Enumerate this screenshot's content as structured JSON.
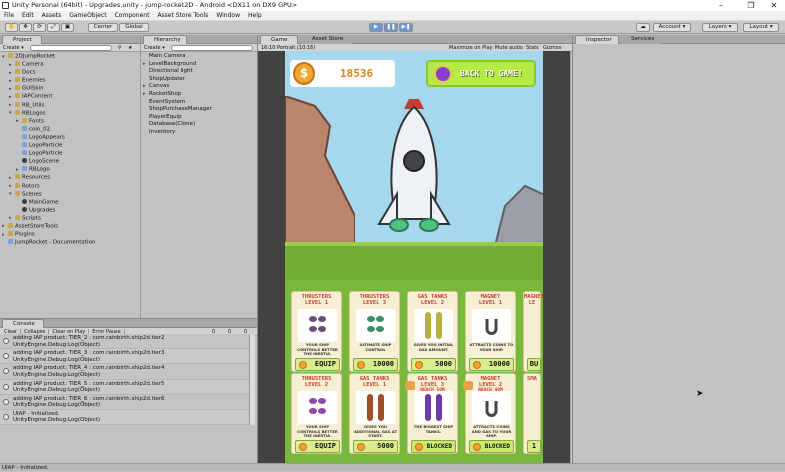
{
  "window": {
    "title": "Unity Personal (64bit) - Upgrades.unity - jump-rocket2D - Android <DX11 on DX9 GPU>",
    "minimize": "–",
    "maximize": "❐",
    "close": "✕"
  },
  "menu": [
    "File",
    "Edit",
    "Assets",
    "GameObject",
    "Component",
    "Asset Store Tools",
    "Window",
    "Help"
  ],
  "toolbar": {
    "center": "Center",
    "global": "Global",
    "account": "Account",
    "layers": "Layers",
    "layout": "Layout"
  },
  "project": {
    "tab": "Project",
    "create": "Create",
    "items": [
      {
        "label": "2DJumpRocket",
        "depth": 0,
        "open": true,
        "icon": "folder"
      },
      {
        "label": "Camera",
        "depth": 1,
        "open": false,
        "icon": "folder"
      },
      {
        "label": "Docs",
        "depth": 1,
        "open": false,
        "icon": "folder"
      },
      {
        "label": "Enemies",
        "depth": 1,
        "open": false,
        "icon": "folder"
      },
      {
        "label": "GUISkin",
        "depth": 1,
        "open": false,
        "icon": "folder"
      },
      {
        "label": "IAPContent",
        "depth": 1,
        "open": false,
        "icon": "folder"
      },
      {
        "label": "RB_Utils",
        "depth": 1,
        "open": false,
        "icon": "folder"
      },
      {
        "label": "RBLogos",
        "depth": 1,
        "open": true,
        "icon": "folder"
      },
      {
        "label": "Fonts",
        "depth": 2,
        "open": false,
        "icon": "folder"
      },
      {
        "label": "coin_02",
        "depth": 2,
        "open": null,
        "icon": "asset"
      },
      {
        "label": "LogoAppears",
        "depth": 2,
        "open": null,
        "icon": "asset"
      },
      {
        "label": "LogoParticle",
        "depth": 2,
        "open": null,
        "icon": "asset"
      },
      {
        "label": "LogoParticle",
        "depth": 2,
        "open": null,
        "icon": "asset"
      },
      {
        "label": "LogoScene",
        "depth": 2,
        "open": null,
        "icon": "scene"
      },
      {
        "label": "RBLogo",
        "depth": 2,
        "open": false,
        "icon": "asset"
      },
      {
        "label": "Resources",
        "depth": 1,
        "open": false,
        "icon": "folder"
      },
      {
        "label": "Rotors",
        "depth": 1,
        "open": false,
        "icon": "folder"
      },
      {
        "label": "Scenes",
        "depth": 1,
        "open": true,
        "icon": "folder"
      },
      {
        "label": "MainGame",
        "depth": 2,
        "open": null,
        "icon": "scene"
      },
      {
        "label": "Upgrades",
        "depth": 2,
        "open": null,
        "icon": "scene"
      },
      {
        "label": "Scripts",
        "depth": 1,
        "open": false,
        "icon": "folder"
      },
      {
        "label": "AssetStoreTools",
        "depth": 0,
        "open": false,
        "icon": "folder"
      },
      {
        "label": "Plugins",
        "depth": 0,
        "open": false,
        "icon": "folder"
      },
      {
        "label": "JumpRocket - Documentation",
        "depth": 0,
        "open": null,
        "icon": "asset"
      }
    ]
  },
  "hierarchy": {
    "tab": "Hierarchy",
    "create": "Create",
    "items": [
      {
        "label": "Main Camera",
        "arrow": false
      },
      {
        "label": "LevelBackground",
        "arrow": true
      },
      {
        "label": "Directional light",
        "arrow": false
      },
      {
        "label": "ShopUpdater",
        "arrow": false
      },
      {
        "label": "Canvas",
        "arrow": true
      },
      {
        "label": "RocketShop",
        "arrow": true
      },
      {
        "label": "EventSystem",
        "arrow": false
      },
      {
        "label": "ShopPurchaseManager",
        "arrow": false
      },
      {
        "label": "PlayerEquip",
        "arrow": false
      },
      {
        "label": "Database(Clone)",
        "arrow": false
      },
      {
        "label": "Inventory",
        "arrow": false
      }
    ]
  },
  "console": {
    "tab": "Console",
    "buttons": [
      "Clear",
      "Collapse",
      "Clear on Play",
      "Error Pause"
    ],
    "counts": [
      "0",
      "0",
      "0"
    ],
    "logs": [
      {
        "line1": "adding IAP product: TIER_2 : com.rainbirth.ship2d.tier2",
        "line2": "UnityEngine.Debug:Log(Object)"
      },
      {
        "line1": "adding IAP product: TIER_3 : com.rainbirth.ship2d.tier3",
        "line2": "UnityEngine.Debug:Log(Object)"
      },
      {
        "line1": "adding IAP product: TIER_4 : com.rainbirth.ship2d.tier4",
        "line2": "UnityEngine.Debug:Log(Object)"
      },
      {
        "line1": "adding IAP product: TIER_5 : com.rainbirth.ship2d.tier5",
        "line2": "UnityEngine.Debug:Log(Object)"
      },
      {
        "line1": "adding IAP product: TIER_6 : com.rainbirth.ship2d.tier6",
        "line2": "UnityEngine.Debug:Log(Object)"
      },
      {
        "line1": "UIAP - Initialized.",
        "line2": "UnityEngine.Debug:Log(Object)"
      }
    ]
  },
  "game": {
    "tab_game": "Game",
    "tab_store": "Asset Store",
    "aspect": "16:10 Portrait (10:16)",
    "opts": [
      "Maximize on Play",
      "Mute audio",
      "Stats",
      "Gizmos"
    ],
    "coins": "18536",
    "back": "BACK TO GAME!",
    "cards": [
      {
        "title1": "THRUSTERS",
        "title2": "LEVEL 1",
        "desc": "YOUR SHIP CONTROLS BETTER THE INERTIA.",
        "btn": "EQUIP",
        "kind": "thruster",
        "reach": ""
      },
      {
        "title1": "THRUSTERS",
        "title2": "LEVEL 3",
        "desc": "ULTIMATE SHIP CONTROL",
        "btn": "10000",
        "kind": "thruster2",
        "reach": ""
      },
      {
        "title1": "GAS TANKS",
        "title2": "LEVEL 2",
        "desc": "GIVES YOU INITIAL GAS AMOUNT.",
        "btn": "5000",
        "kind": "tank_green",
        "reach": ""
      },
      {
        "title1": "MAGNET",
        "title2": "LEVEL 1",
        "desc": "ATTRACTS COINS TO YOUR SHIP.",
        "btn": "10000",
        "kind": "magnet",
        "reach": ""
      },
      {
        "title1": "MAGNET",
        "title2": "LE",
        "desc": "",
        "btn": "BU",
        "kind": "partial",
        "reach": ""
      },
      {
        "title1": "THRUSTERS",
        "title2": "LEVEL 2",
        "desc": "YOUR SHIP CONTROLS BETTER THE INERTIA.",
        "btn": "EQUIP",
        "kind": "thruster_purple",
        "reach": ""
      },
      {
        "title1": "GAS TANKS",
        "title2": "LEVEL 1",
        "desc": "GIVES YOU ADDITIONAL GAS AT START.",
        "btn": "5000",
        "kind": "tank_brown",
        "reach": ""
      },
      {
        "title1": "GAS TANKS",
        "title2": "LEVEL 3",
        "desc": "THE BIGGEST SHIP TANKS.",
        "btn": "BLOCKED",
        "kind": "tank_purple",
        "reach": "REACH 50M"
      },
      {
        "title1": "MAGNET",
        "title2": "LEVEL 2",
        "desc": "ATTRACTS COINS AND GAS TO YOUR SHIP.",
        "btn": "BLOCKED",
        "kind": "magnet",
        "reach": "REACH 40M"
      },
      {
        "title1": "SMA",
        "title2": "",
        "desc": "",
        "btn": "1",
        "kind": "partial",
        "reach": ""
      }
    ]
  },
  "inspector": {
    "tab": "Inspector",
    "tab2": "Services"
  },
  "status": "UIAP - Initialized.",
  "colors": {
    "accent_red": "#c83c29",
    "coin": "#f1a630",
    "back_btn": "#b6ea45",
    "sky": "#a6d8ed"
  }
}
